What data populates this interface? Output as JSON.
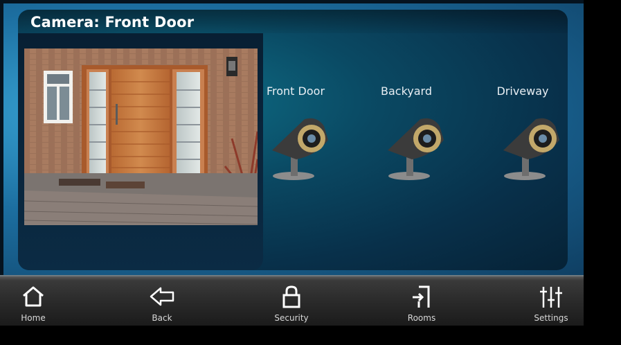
{
  "panel": {
    "title": "Camera: Front Door"
  },
  "cameras": [
    {
      "label": "Front Door",
      "icon": "security-camera-icon"
    },
    {
      "label": "Backyard",
      "icon": "security-camera-icon"
    },
    {
      "label": "Driveway",
      "icon": "security-camera-icon"
    }
  ],
  "nav": {
    "home": {
      "label": "Home",
      "icon": "home-icon"
    },
    "back": {
      "label": "Back",
      "icon": "back-arrow-icon"
    },
    "security": {
      "label": "Security",
      "icon": "lock-icon"
    },
    "rooms": {
      "label": "Rooms",
      "icon": "door-enter-icon"
    },
    "settings": {
      "label": "Settings",
      "icon": "sliders-icon"
    }
  },
  "colors": {
    "accent": "#2a8fc4",
    "panel": "#0a4963",
    "navbar": "#2a2a2a"
  }
}
